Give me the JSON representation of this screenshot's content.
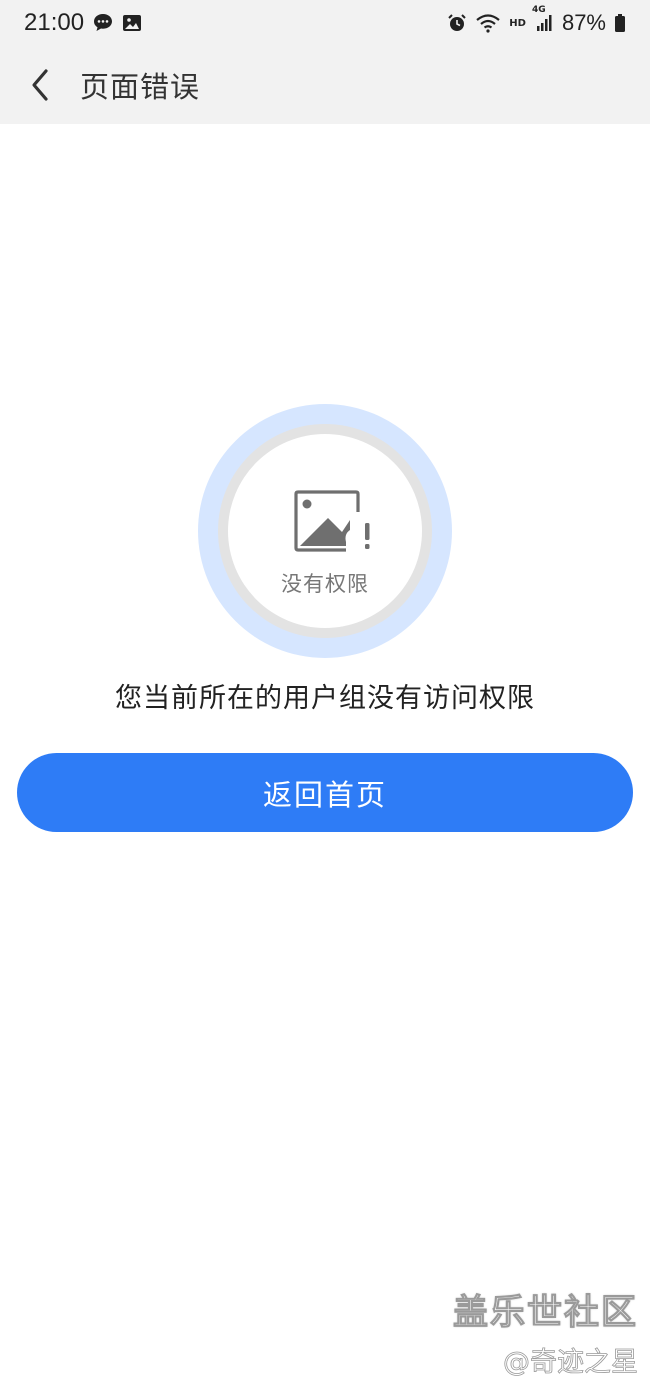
{
  "status_bar": {
    "time": "21:00",
    "left_icons": [
      "chat-bubble-icon",
      "gallery-icon"
    ],
    "right_icons": [
      "alarm-icon",
      "wifi-icon",
      "signal-icon",
      "battery-icon"
    ],
    "hd_label": "HD",
    "network_label": "4G",
    "battery": "87%"
  },
  "header": {
    "title": "页面错误",
    "back_icon": "chevron-left-icon"
  },
  "error_graphic": {
    "icon": "broken-image-icon",
    "label": "没有权限"
  },
  "message": "您当前所在的用户组没有访问权限",
  "home_button_label": "返回首页",
  "watermark": {
    "main": "盖乐世社区",
    "sub": "@奇迹之星"
  },
  "colors": {
    "accent": "#2e7cf6",
    "header_bg": "#f2f2f2",
    "circle_outer": "#d6e6ff",
    "circle_ring": "#e3e3e3"
  }
}
